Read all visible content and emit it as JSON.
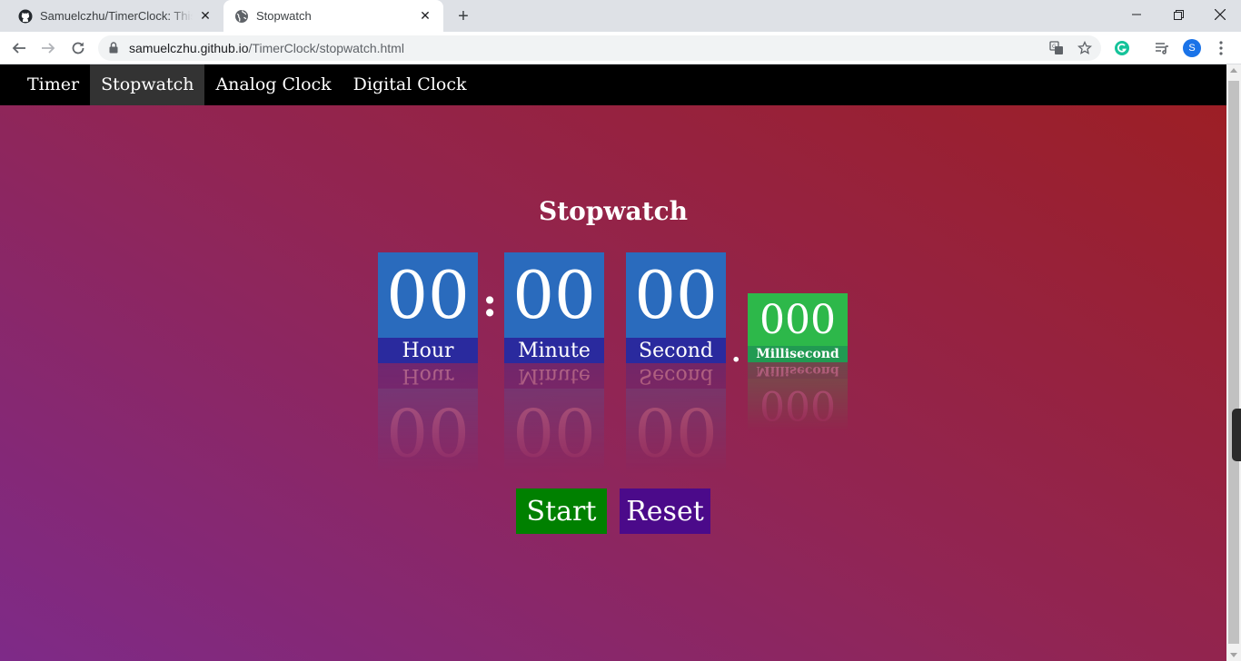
{
  "browser": {
    "tabs": [
      {
        "title": "Samuelczhu/TimerClock: This w",
        "icon": "github-icon",
        "active": false
      },
      {
        "title": "Stopwatch",
        "icon": "globe-icon",
        "active": true
      }
    ],
    "url_host": "samuelczhu.github.io",
    "url_path": "/TimerClock/stopwatch.html",
    "profile_initial": "S"
  },
  "nav": {
    "items": [
      {
        "label": "Timer",
        "active": false
      },
      {
        "label": "Stopwatch",
        "active": true
      },
      {
        "label": "Analog Clock",
        "active": false
      },
      {
        "label": "Digital Clock",
        "active": false
      }
    ]
  },
  "page": {
    "title": "Stopwatch",
    "hour": {
      "value": "00",
      "label": "Hour"
    },
    "minute": {
      "value": "00",
      "label": "Minute"
    },
    "second": {
      "value": "00",
      "label": "Second"
    },
    "millisecond": {
      "value": "000",
      "label": "Millisecond"
    },
    "colon": ":",
    "dot": "."
  },
  "buttons": {
    "start": "Start",
    "reset": "Reset"
  },
  "colors": {
    "digit_box": "#2a6bbd",
    "digit_label": "#2a2a9e",
    "ms_box": "#2db84a",
    "ms_label": "#219a52",
    "start_button": "#008000",
    "reset_button": "#4b0a8a"
  }
}
